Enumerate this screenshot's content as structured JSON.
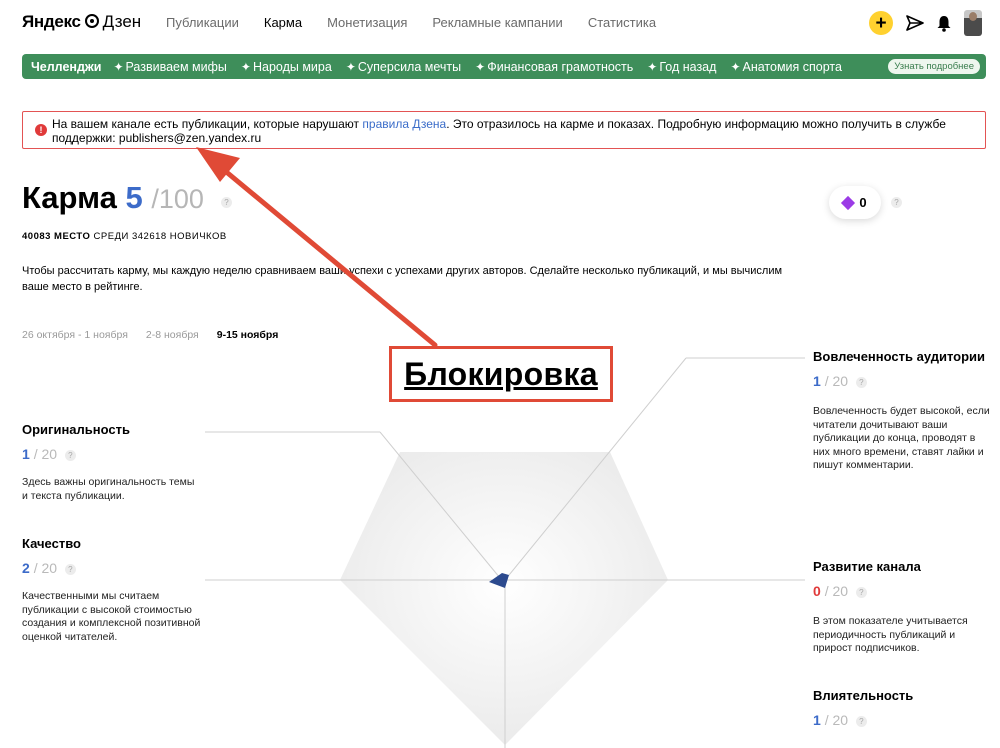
{
  "header": {
    "logo_brand": "Яндекс",
    "logo_product": "Дзен",
    "nav": [
      "Публикации",
      "Карма",
      "Монетизация",
      "Рекламные кампании",
      "Статистика"
    ],
    "active_nav": "Карма",
    "icons": [
      "plus-icon",
      "send-icon",
      "bell-icon",
      "avatar"
    ],
    "accent_color": "#ffd12f"
  },
  "challenges": {
    "title": "Челленджи",
    "items": [
      "Развиваем мифы",
      "Народы мира",
      "Суперсила мечты",
      "Финансовая грамотность",
      "Год назад",
      "Анатомия спорта"
    ],
    "more_label": "Узнать подробнее",
    "color": "#3e8e5a"
  },
  "warning": {
    "text_before": "На вашем канале есть публикации, которые нарушают ",
    "link": "правила Дзена",
    "text_after": ". Это отразилось на карме и показах. Подробную информацию можно получить в службе поддержки: publishers@zen.yandex.ru",
    "icon": "exclamation-icon"
  },
  "karma": {
    "title": "Карма",
    "value": "5",
    "total": "/100",
    "rank_place": "40083 место",
    "rank_rest": "среди 342618 новичков",
    "description": "Чтобы рассчитать карму, мы каждую неделю сравниваем ваши успехи с успехами других авторов. Сделайте несколько публикаций, и мы вычислим ваше место в рейтинге.",
    "gems": "0"
  },
  "weeks": [
    "26 октября - 1 ноября",
    "2-8 ноября",
    "9-15 ноября"
  ],
  "active_week": "9-15 ноября",
  "metrics": {
    "originality": {
      "name": "Оригинальность",
      "value": "1",
      "total": "/ 20",
      "note": "Здесь важны оригинальность темы и текста публикации."
    },
    "quality": {
      "name": "Качество",
      "value": "2",
      "total": "/ 20",
      "note": "Качественными мы считаем публикации с высокой стоимостью создания и комплексной позитивной оценкой читателей."
    },
    "engagement": {
      "name": "Вовлеченность аудитории",
      "value": "1",
      "total": "/ 20",
      "note": "Вовлеченность будет высокой, если читатели дочитывают ваши публикации до конца, проводят в них много времени, ставят лайки и пишут комментарии."
    },
    "growth": {
      "name": "Развитие канала",
      "value": "0",
      "total": "/ 20",
      "note": "В этом показателе учитывается периодичность публикаций и прирост подписчиков."
    },
    "influence": {
      "name": "Влиятельность",
      "value": "1",
      "total": "/ 20"
    }
  },
  "annotation": "Блокировка",
  "annotation_color": "#e04a36"
}
